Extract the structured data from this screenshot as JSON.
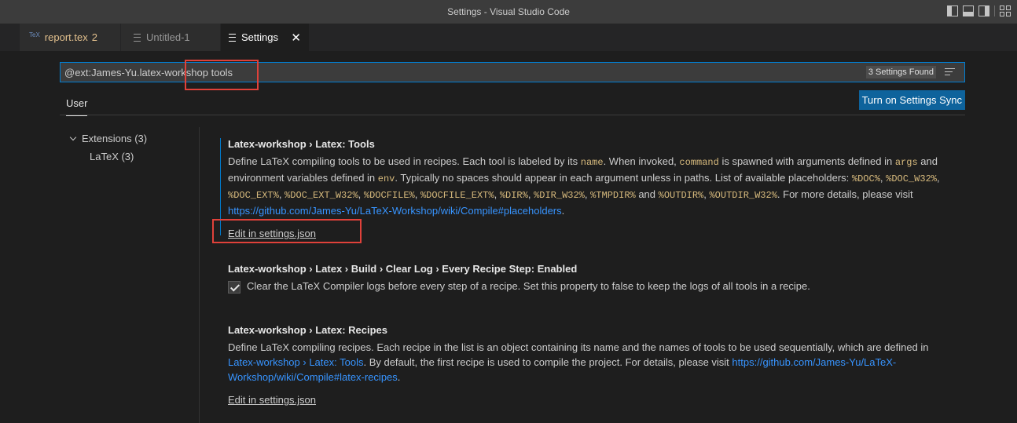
{
  "window": {
    "title": "Settings - Visual Studio Code"
  },
  "tabs": [
    {
      "label": "report.tex",
      "badge": "2",
      "icon": "tex-icon"
    },
    {
      "label": "Untitled-1",
      "icon": "file-icon"
    },
    {
      "label": "Settings",
      "icon": "settings-file-icon",
      "close": "✕"
    }
  ],
  "search": {
    "query": "@ext:James-Yu.latex-workshop tools",
    "results": "3 Settings Found"
  },
  "scope": {
    "user_tab": "User",
    "sync_button": "Turn on Settings Sync"
  },
  "toc": {
    "group": "Extensions (3)",
    "item": "LaTeX (3)"
  },
  "settings": {
    "tools": {
      "prefix": "Latex-workshop › Latex: ",
      "name": "Tools",
      "d1": "Define LaTeX compiling tools to be used in recipes. Each tool is labeled by its ",
      "c_name": "name",
      "d2": ". When invoked, ",
      "c_command": "command",
      "d3": " is spawned with arguments defined in ",
      "c_args": "args",
      "d4": " and environment variables defined in ",
      "c_env": "env",
      "d5": ". Typically no spaces should appear in each argument unless in paths. List of available placeholders: ",
      "c_p1": "%DOC%",
      "s1": ", ",
      "c_p2": "%DOC_W32%",
      "s2": ", ",
      "c_p3": "%DOC_EXT%",
      "s3": ", ",
      "c_p4": "%DOC_EXT_W32%",
      "s4": ", ",
      "c_p5": "%DOCFILE%",
      "s5": ", ",
      "c_p6": "%DOCFILE_EXT%",
      "s6": ", ",
      "c_p7": "%DIR%",
      "s7": ", ",
      "c_p8": "%DIR_W32%",
      "s8": ", ",
      "c_p9": "%TMPDIR%",
      "s9": " and ",
      "c_p10": "%OUTDIR%",
      "s10": ", ",
      "c_p11": "%OUTDIR_W32%",
      "d6": ". For more details, please visit ",
      "link": "https://github.com/James-Yu/LaTeX-Workshop/wiki/Compile#placeholders",
      "d7": ".",
      "edit": "Edit in settings.json"
    },
    "clearlog": {
      "title": "Latex-workshop › Latex › Build › Clear Log › Every Recipe Step: ",
      "name": "Enabled",
      "desc": "Clear the LaTeX Compiler logs before every step of a recipe. Set this property to false to keep the logs of all tools in a recipe.",
      "checked": true
    },
    "recipes": {
      "prefix": "Latex-workshop › Latex: ",
      "name": "Recipes",
      "d1": "Define LaTeX compiling recipes. Each recipe in the list is an object containing its name and the names of tools to be used sequentially, which are defined in ",
      "link1": "Latex-workshop › Latex: Tools",
      "d2": ". By default, the first recipe is used to compile the project. For details, please visit ",
      "link2": "https://github.com/James-Yu/LaTeX-Workshop/wiki/Compile#latex-recipes",
      "d3": ".",
      "edit": "Edit in settings.json"
    }
  },
  "colors": {
    "accent": "#007fd4",
    "button": "#0e639c",
    "annotation": "#e0413a",
    "code": "#d7ba7d",
    "link": "#3794ff"
  }
}
